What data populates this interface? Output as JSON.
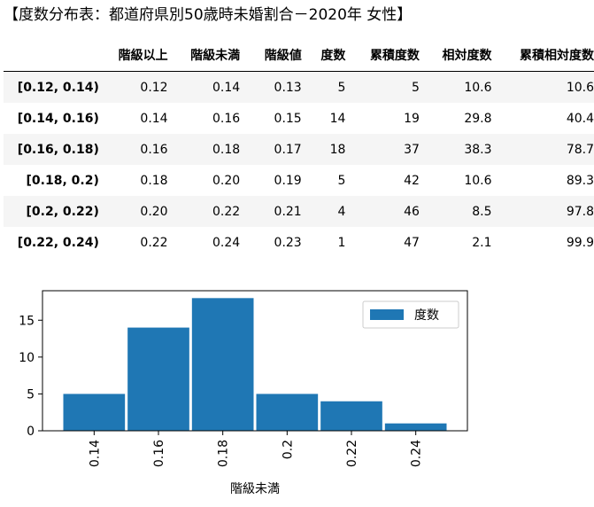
{
  "title": "【度数分布表：都道府県別50歳時未婚割合－2020年 女性】",
  "table": {
    "headers": [
      "",
      "階級以上",
      "階級未満",
      "階級値",
      "度数",
      "累積度数",
      "相対度数",
      "累積相対度数"
    ],
    "rows": [
      [
        "[0.12, 0.14)",
        "0.12",
        "0.14",
        "0.13",
        "5",
        "5",
        "10.6",
        "10.6"
      ],
      [
        "[0.14, 0.16)",
        "0.14",
        "0.16",
        "0.15",
        "14",
        "19",
        "29.8",
        "40.4"
      ],
      [
        "[0.16, 0.18)",
        "0.16",
        "0.18",
        "0.17",
        "18",
        "37",
        "38.3",
        "78.7"
      ],
      [
        "[0.18, 0.2)",
        "0.18",
        "0.20",
        "0.19",
        "5",
        "42",
        "10.6",
        "89.3"
      ],
      [
        "[0.2, 0.22)",
        "0.20",
        "0.22",
        "0.21",
        "4",
        "46",
        "8.5",
        "97.8"
      ],
      [
        "[0.22, 0.24)",
        "0.22",
        "0.24",
        "0.23",
        "1",
        "47",
        "2.1",
        "99.9"
      ]
    ]
  },
  "chart_data": {
    "type": "bar",
    "categories": [
      "0.14",
      "0.16",
      "0.18",
      "0.2",
      "0.22",
      "0.24"
    ],
    "series": [
      {
        "name": "度数",
        "values": [
          5,
          14,
          18,
          5,
          4,
          1
        ]
      }
    ],
    "xlabel": "階級未満",
    "ylabel": "",
    "ylim": [
      0,
      19
    ],
    "yticks": [
      0,
      5,
      10,
      15
    ],
    "legend": "top-right",
    "grid": false,
    "color": "#1f77b4"
  }
}
